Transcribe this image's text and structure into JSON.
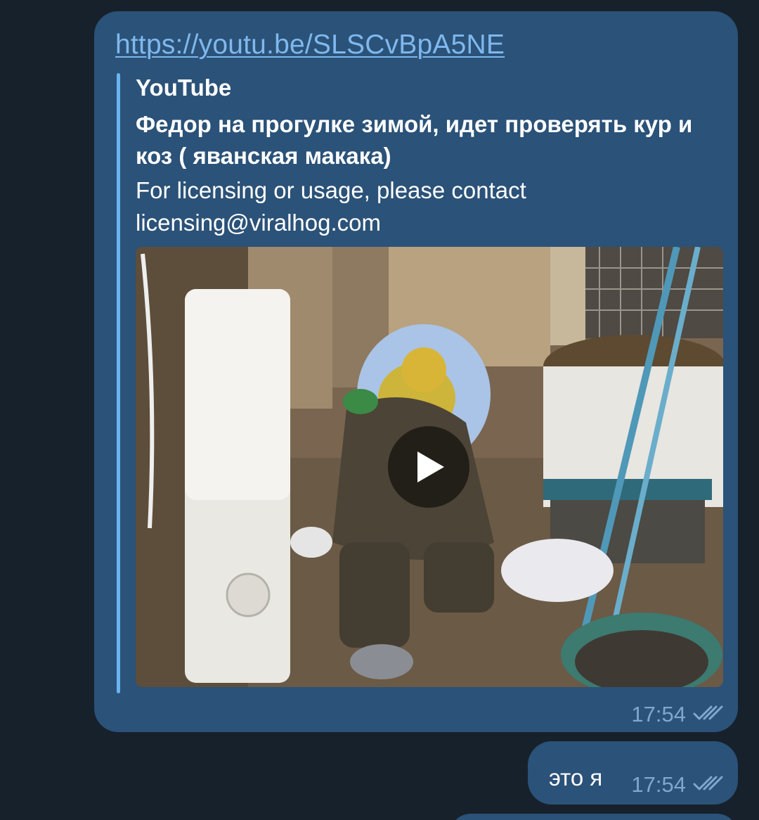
{
  "messages": [
    {
      "link": "https://youtu.be/SLSCvBpA5NE",
      "preview": {
        "site_name": "YouTube",
        "title": "Федор на прогулке зимой, идет проверять кур и коз ( яванская макака)",
        "description": "For licensing or usage, please contact licensing@viralhog.com",
        "thumbnail_icon": "video-thumbnail",
        "play_icon": "play-icon"
      },
      "time": "17:54",
      "status_icon": "double-check-icon"
    },
    {
      "text": "это я",
      "time": "17:54",
      "status_icon": "double-check-icon"
    }
  ],
  "colors": {
    "background": "#17212b",
    "outgoing_bubble": "#2b5278",
    "link": "#7fb8ee",
    "preview_accent": "#6ab3f3",
    "meta": "#7fa8cf"
  }
}
